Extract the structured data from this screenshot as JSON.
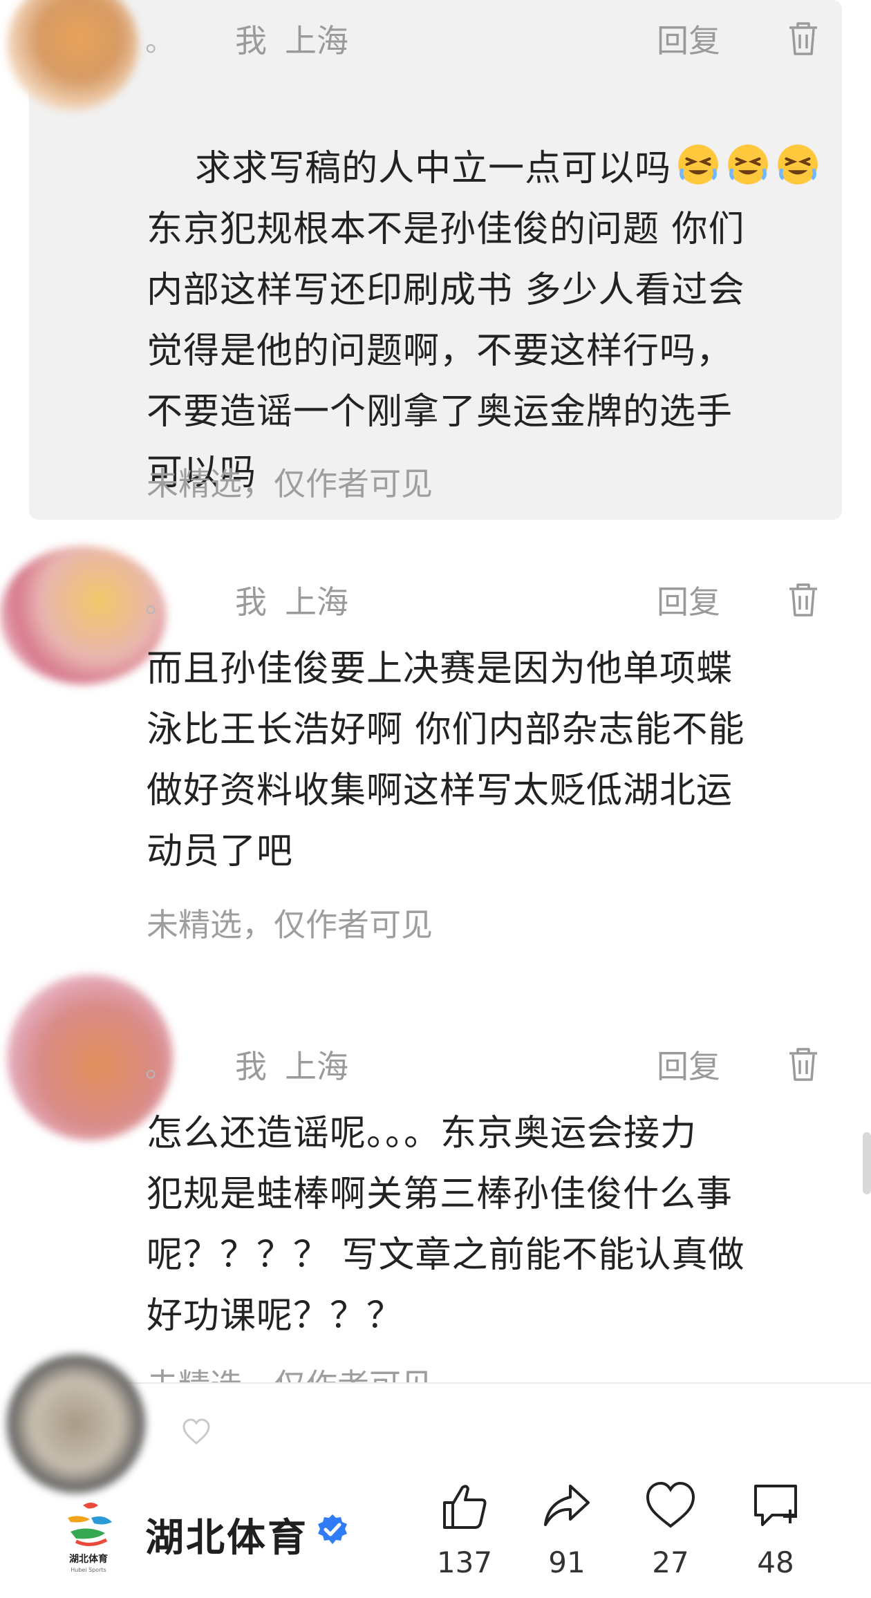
{
  "comments": [
    {
      "user": "我",
      "location": "上海",
      "reply_label": "回复",
      "text_line1": "求求写稿的人中立一点可以吗",
      "text_rest": "东京犯规根本不是孙佳俊的问题 你们\n内部这样写还印刷成书 多少人看过会\n觉得是他的问题啊，不要这样行吗，\n不要造谣一个刚拿了奥运金牌的选手\n可以吗",
      "status": "未精选，仅作者可见",
      "emoji": [
        "grinning-squint-emoji",
        "grinning-squint-emoji",
        "grinning-squint-emoji"
      ]
    },
    {
      "user": "我",
      "location": "上海",
      "reply_label": "回复",
      "text": "而且孙佳俊要上决赛是因为他单项蝶\n泳比王长浩好啊 你们内部杂志能不能\n做好资料收集啊这样写太贬低湖北运\n动员了吧",
      "status": "未精选，仅作者可见"
    },
    {
      "user": "我",
      "location": "上海",
      "reply_label": "回复",
      "text": "怎么还造谣呢。。。东京奥运会接力\n犯规是蛙棒啊关第三棒孙佳俊什么事\n呢？？？？ 写文章之前能不能认真做\n好功课呢？？？",
      "status": "未精选，仅作者可见"
    }
  ],
  "account": {
    "name": "湖北体育",
    "logo_text": "湖北体育",
    "logo_subtext": "Hubei Sports"
  },
  "actions": {
    "like_count": "137",
    "share_count": "91",
    "favorite_count": "27",
    "comment_count": "48"
  },
  "colors": {
    "highlight_bg": "#f1f1f1",
    "meta_text": "#9a9a9a",
    "verified_blue": "#2f7cf6"
  }
}
